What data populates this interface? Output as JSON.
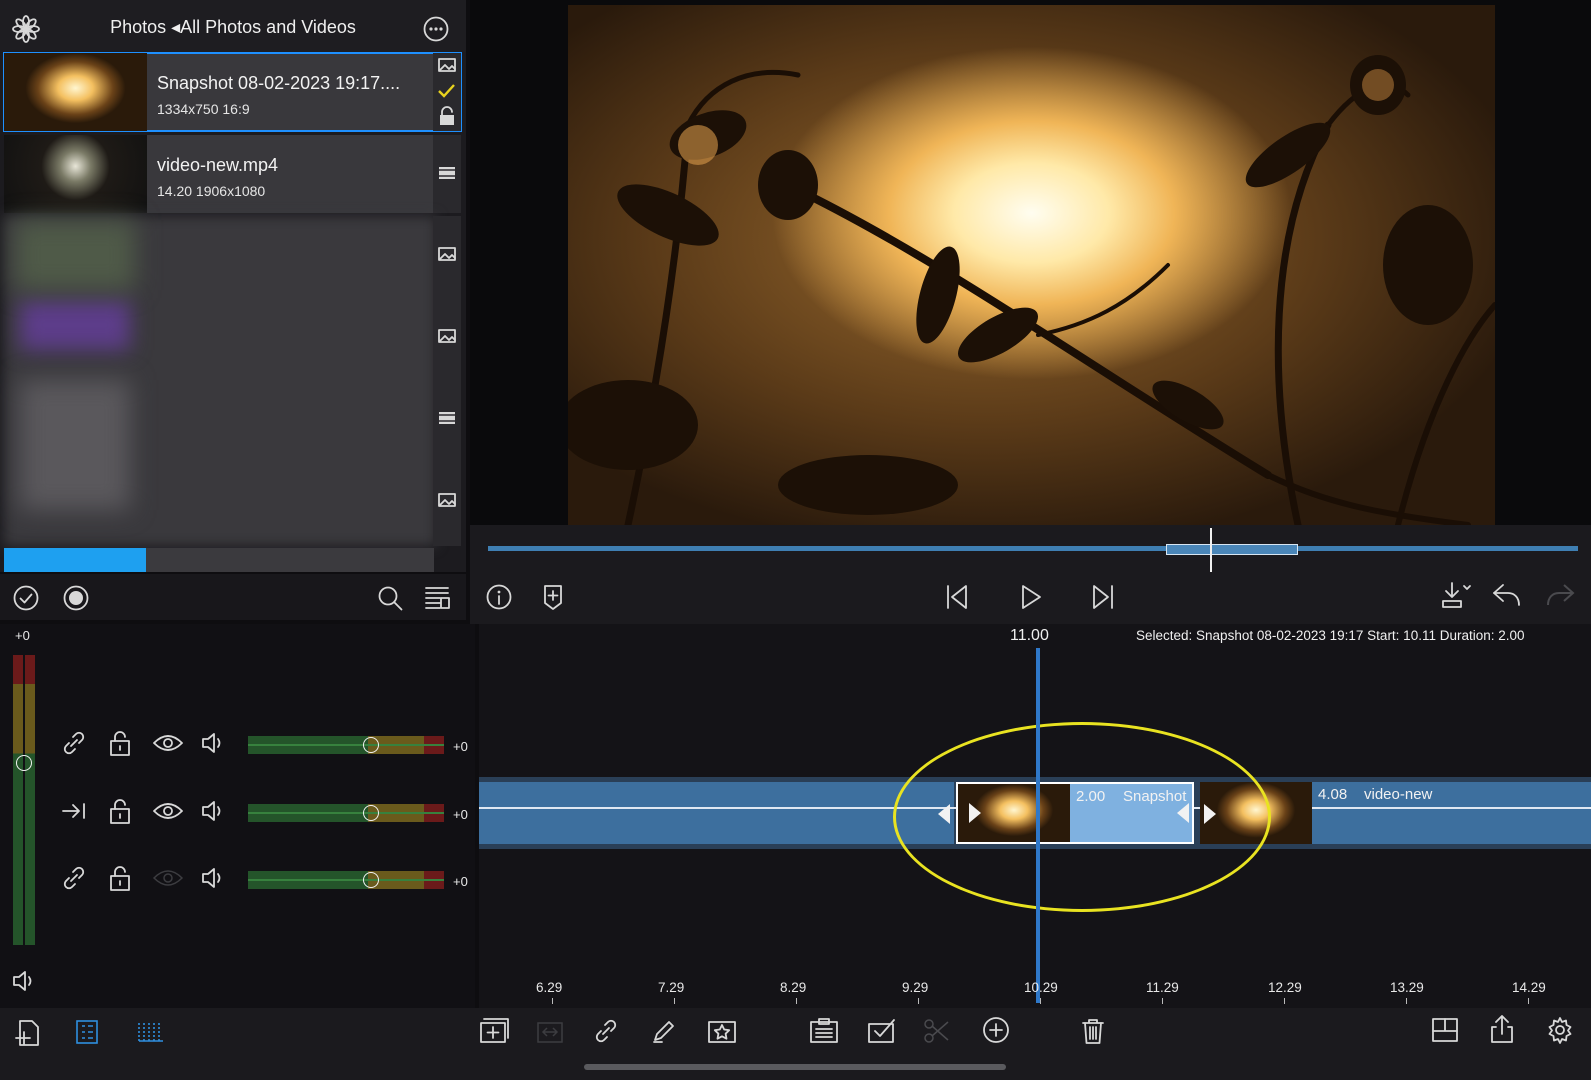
{
  "browser": {
    "title": "Photos ◂All Photos and Videos",
    "items": [
      {
        "name": "Snapshot 08-02-2023 19:17....",
        "meta": "1334x750  16:9",
        "type": "image",
        "selected": true
      },
      {
        "name": "video-new.mp4",
        "meta": "14.20  1906x1080",
        "type": "video",
        "selected": false
      }
    ],
    "side_icons": [
      "image-icon",
      "image-icon",
      "video-icon",
      "image-icon"
    ],
    "progress_fraction": 0.33
  },
  "transport": {
    "info": "info-icon",
    "marker": "add-marker-icon"
  },
  "timeline": {
    "playhead_time": "11.00",
    "status": "Selected: Snapshot 08-02-2023 19:17 Start: 10.11 Duration: 2.00",
    "master_level": "+0",
    "tracks": [
      {
        "link": "link-icon",
        "gain": "+0"
      },
      {
        "link": "forward-icon",
        "gain": "+0"
      },
      {
        "link": "link-icon",
        "gain": "+0"
      }
    ],
    "clips": [
      {
        "duration": "2.00",
        "name": "Snapshot"
      },
      {
        "duration": "4.08",
        "name": "video-new"
      }
    ],
    "ticks": [
      "6.29",
      "7.29",
      "8.29",
      "9.29",
      "10.29",
      "11.29",
      "12.29",
      "13.29",
      "14.29"
    ]
  },
  "colors": {
    "accent": "#1ea0f0",
    "track": "#3d6f9e",
    "selected_clip": "#7fb1e0",
    "playhead": "#2f78c9",
    "highlight": "#e9e321"
  }
}
